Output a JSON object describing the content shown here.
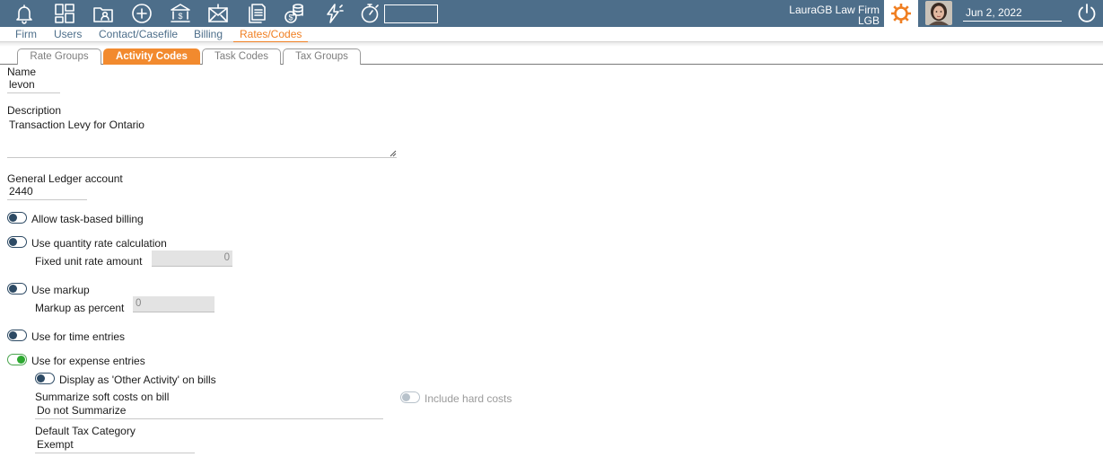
{
  "header": {
    "search_value": "",
    "firm_name": "LauraGB Law Firm",
    "firm_code": "LGB",
    "date": "Jun 2, 2022",
    "icons": [
      "bell-icon",
      "dashboard-icon",
      "contacts-folder-icon",
      "add-icon",
      "bank-icon",
      "mail-money-icon",
      "documents-icon",
      "coins-icon",
      "lightning-icon",
      "stopwatch-icon"
    ],
    "colors": {
      "bar": "#4d6e8a",
      "accent": "#f07f22"
    }
  },
  "nav": {
    "items": [
      "Firm",
      "Users",
      "Contact/Casefile",
      "Billing",
      "Rates/Codes"
    ],
    "active": "Rates/Codes"
  },
  "subtabs": {
    "items": [
      "Rate Groups",
      "Activity Codes",
      "Task Codes",
      "Tax Groups"
    ],
    "active": "Activity Codes"
  },
  "form": {
    "name_label": "Name",
    "name_value": "levon",
    "description_label": "Description",
    "description_value": "Transaction Levy for Ontario",
    "gl_label": "General Ledger account",
    "gl_value": "2440",
    "task_billing_label": "Allow task-based billing",
    "task_billing_on": false,
    "quantity_rate_label": "Use quantity rate calculation",
    "quantity_rate_on": false,
    "fixed_unit_label": "Fixed unit rate amount",
    "fixed_unit_value": "0",
    "markup_label": "Use markup",
    "markup_on": false,
    "markup_percent_label": "Markup as percent",
    "markup_percent_value": "0",
    "time_entries_label": "Use for time entries",
    "time_entries_on": false,
    "expense_entries_label": "Use for expense entries",
    "expense_entries_on": true,
    "other_activity_label": "Display as 'Other Activity' on bills",
    "other_activity_on": false,
    "summarize_label": "Summarize soft costs on bill",
    "summarize_value": "Do not Summarize",
    "hard_costs_label": "Include hard costs",
    "hard_costs_on": false,
    "tax_category_label": "Default Tax Category",
    "tax_category_value": "Exempt"
  }
}
